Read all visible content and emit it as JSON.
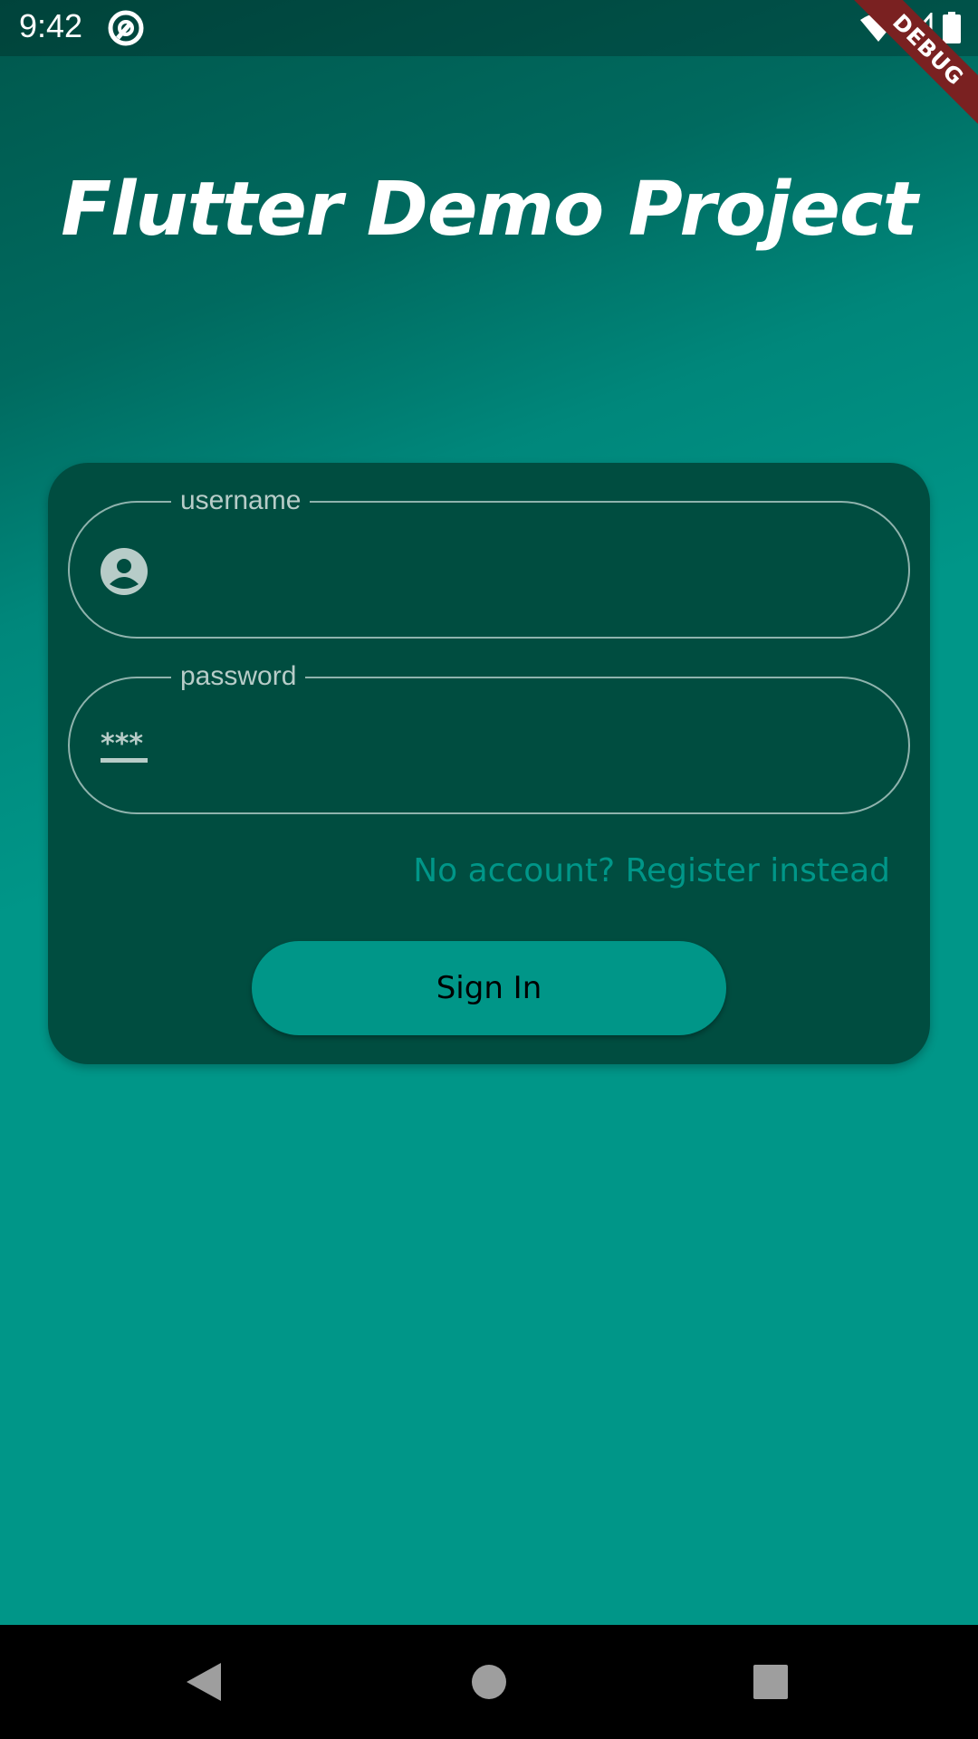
{
  "status_bar": {
    "time": "9:42",
    "icons": [
      "app-notification-icon",
      "wifi-icon",
      "cell-signal-icon",
      "battery-icon"
    ]
  },
  "debug_banner": {
    "label": "DEBUG",
    "color": "#7a2121"
  },
  "app": {
    "title": "Flutter Demo Project"
  },
  "login_form": {
    "username": {
      "label": "username",
      "value": "",
      "icon": "account-circle-icon"
    },
    "password": {
      "label": "password",
      "value": "",
      "icon": "password-icon"
    },
    "register_link": "No account? Register instead",
    "sign_in_button": "Sign In"
  },
  "nav_bar": {
    "buttons": [
      "back-icon",
      "home-icon",
      "recents-icon"
    ]
  },
  "colors": {
    "primary": "#009688",
    "card": "#004d40",
    "field_border": "#8fb3ad",
    "label": "#b7ccc8"
  }
}
